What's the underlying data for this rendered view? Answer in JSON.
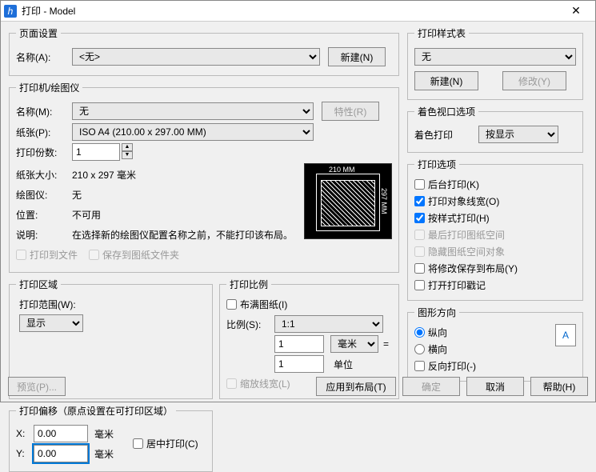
{
  "window": {
    "title": "打印 - Model",
    "icon_letter": "h"
  },
  "page_setup": {
    "legend": "页面设置",
    "name_label": "名称(A):",
    "name_value": "<无>",
    "new_button": "新建(N)"
  },
  "printer": {
    "legend": "打印机/绘图仪",
    "name_label": "名称(M):",
    "name_value": "无",
    "properties_button": "特性(R)",
    "paper_label": "纸张(P):",
    "paper_value": "ISO A4 (210.00 x 297.00 MM)",
    "copies_label": "打印份数:",
    "copies_value": "1",
    "size_label": "纸张大小:",
    "size_value": "210 x 297  毫米",
    "plotter_label": "绘图仪:",
    "plotter_value": "无",
    "location_label": "位置:",
    "location_value": "不可用",
    "desc_label": "说明:",
    "desc_value": "在选择新的绘图仪配置名称之前，不能打印该布局。",
    "to_file_cb": "打印到文件",
    "save_sheet_cb": "保存到图纸文件夹",
    "preview_w": "210 MM",
    "preview_h": "297 MM"
  },
  "area": {
    "legend": "打印区域",
    "range_label": "打印范围(W):",
    "range_value": "显示"
  },
  "scale": {
    "legend": "打印比例",
    "fit_cb": "布满图纸(I)",
    "ratio_label": "比例(S):",
    "ratio_value": "1:1",
    "num1": "1",
    "unit1": "毫米",
    "eq": "=",
    "num2": "1",
    "unit2": "单位",
    "scale_lw_cb": "缩放线宽(L)"
  },
  "offset": {
    "legend": "打印偏移（原点设置在可打印区域）",
    "x_label": "X:",
    "x_value": "0.00",
    "y_label": "Y:",
    "y_value": "0.00",
    "unit": "毫米",
    "center_cb": "居中打印(C)"
  },
  "style_table": {
    "legend": "打印样式表",
    "value": "无",
    "new_button": "新建(N)",
    "modify_button": "修改(Y)"
  },
  "shade": {
    "legend": "着色视口选项",
    "label": "着色打印",
    "value": "按显示"
  },
  "options": {
    "legend": "打印选项",
    "bg": "后台打印(K)",
    "lw": "打印对象线宽(O)",
    "style": "按样式打印(H)",
    "last_ps": "最后打印图纸空间",
    "hide_ps": "隐藏图纸空间对象",
    "save_layout": "将修改保存到布局(Y)",
    "stamp": "打开打印戳记"
  },
  "orient": {
    "legend": "图形方向",
    "portrait": "纵向",
    "landscape": "横向",
    "reverse": "反向打印(-)",
    "letter": "A"
  },
  "buttons": {
    "preview": "预览(P)...",
    "apply": "应用到布局(T)",
    "ok": "确定",
    "cancel": "取消",
    "help": "帮助(H)"
  }
}
